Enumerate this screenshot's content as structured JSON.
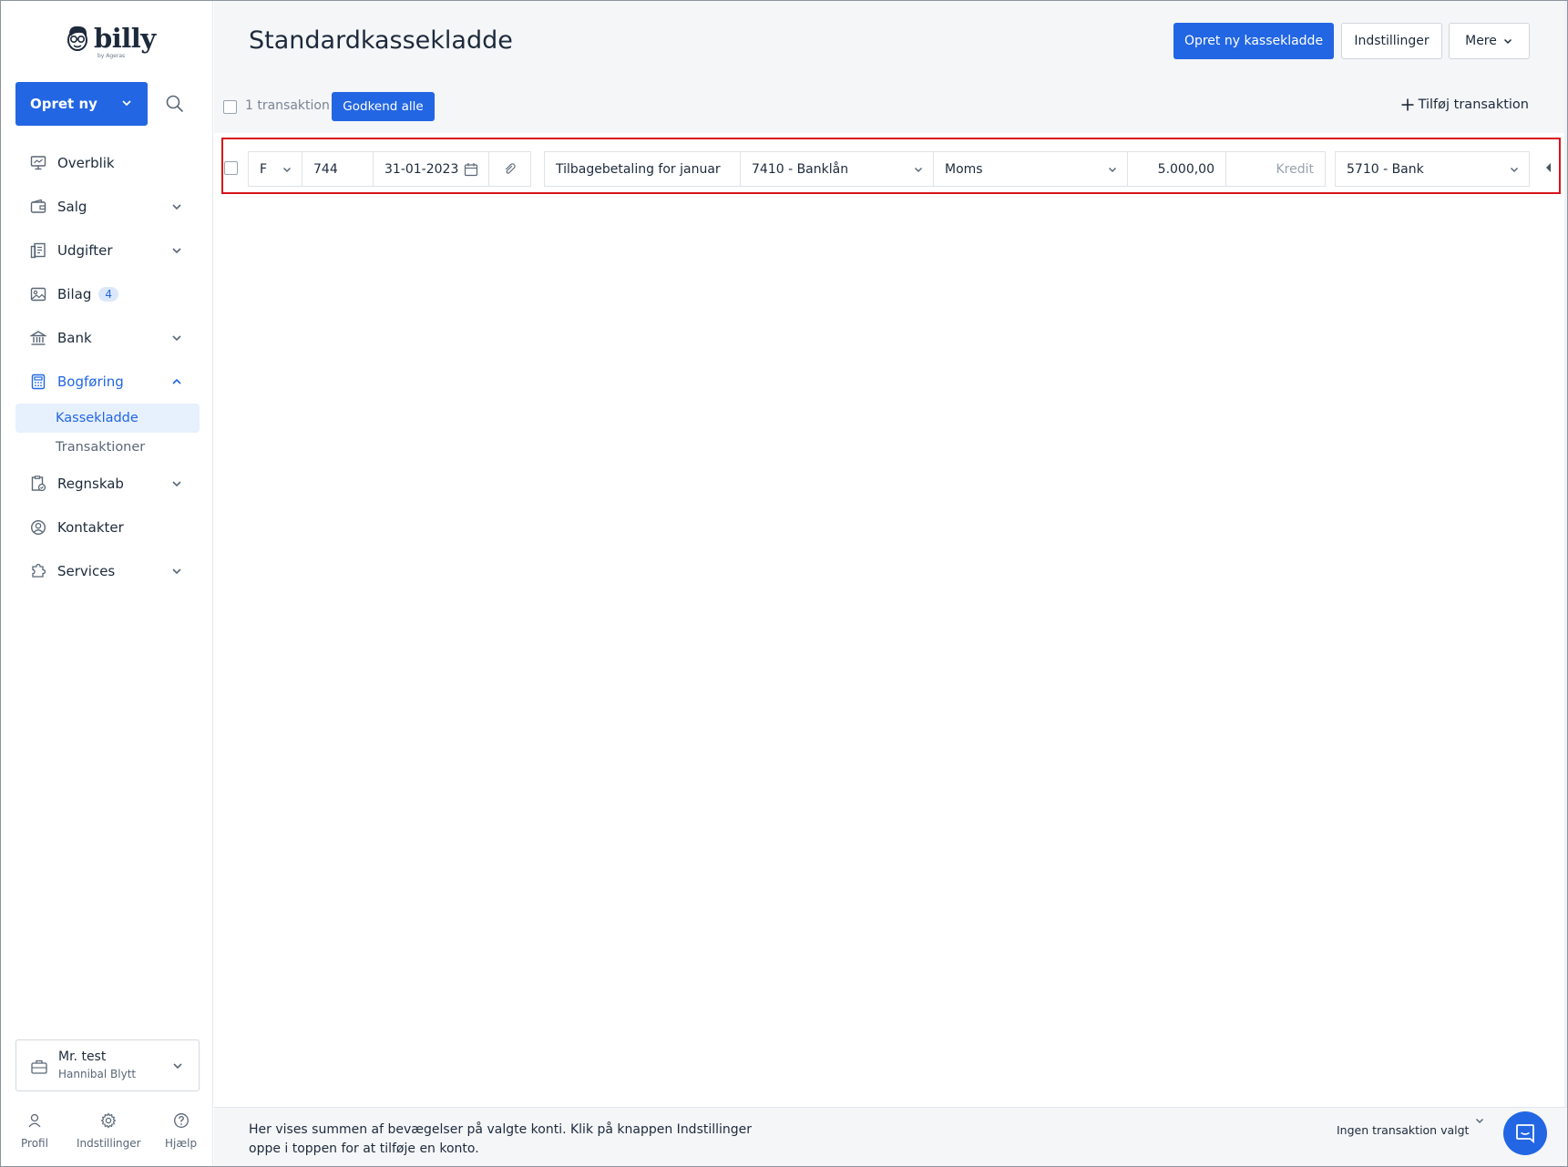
{
  "app": {
    "logo_text": "billy",
    "logo_sub": "by Ageras"
  },
  "sidebar": {
    "create_label": "Opret ny",
    "items": [
      {
        "label": "Overblik",
        "icon": "monitor-icon"
      },
      {
        "label": "Salg",
        "icon": "wallet-icon"
      },
      {
        "label": "Udgifter",
        "icon": "receipt-icon"
      },
      {
        "label": "Bilag",
        "icon": "image-icon",
        "badge": "4"
      },
      {
        "label": "Bank",
        "icon": "bank-icon"
      },
      {
        "label": "Bogføring",
        "icon": "calculator-icon"
      },
      {
        "label": "Regnskab",
        "icon": "report-icon"
      },
      {
        "label": "Kontakter",
        "icon": "contact-icon"
      },
      {
        "label": "Services",
        "icon": "puzzle-icon"
      }
    ],
    "sub_items": [
      "Kassekladde",
      "Transaktioner"
    ],
    "company": {
      "name": "Mr. test",
      "user": "Hannibal Blytt"
    },
    "bottom": [
      "Profil",
      "Indstillinger",
      "Hjælp"
    ]
  },
  "header": {
    "title": "Standardkassekladde",
    "primary_btn": "Opret ny kassekladde",
    "settings_btn": "Indstillinger",
    "more_btn": "Mere"
  },
  "toolbar": {
    "count": "1 transaktion",
    "approve_btn": "Godkend alle",
    "add_tx": "Tilføj transaktion"
  },
  "row": {
    "type": "F",
    "number": "744",
    "date": "31-01-2023",
    "description": "Tilbagebetaling for januar",
    "account": "7410 - Banklån",
    "vat": "Moms",
    "debit": "5.000,00",
    "credit_placeholder": "Kredit",
    "contra_account": "5710 - Bank"
  },
  "footer": {
    "text": "Her vises summen af bevægelser på valgte konti. Klik på knappen Indstillinger oppe i toppen for at tilføje en konto.",
    "status": "Ingen transaktion valgt"
  },
  "colors": {
    "accent": "#2266e3",
    "highlight": "#d7141a"
  }
}
